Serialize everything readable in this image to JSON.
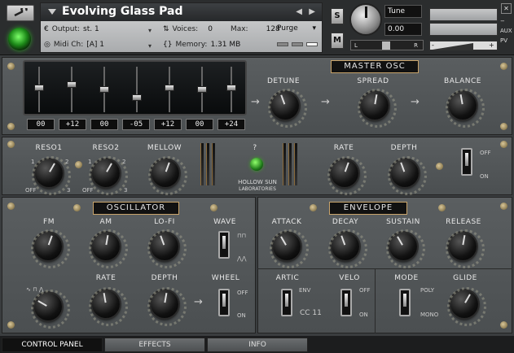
{
  "header": {
    "instrument_name": "Evolving Glass Pad",
    "output_label": "Output:",
    "output_value": "st. 1",
    "voices_label": "Voices:",
    "voices_value": "0",
    "max_label": "Max:",
    "max_value": "128",
    "purge_label": "Purge",
    "midi_label": "Midi Ch:",
    "midi_value": "[A]  1",
    "memory_label": "Memory:",
    "memory_value": "1.31 MB",
    "s_label": "S",
    "m_label": "M",
    "tune_label": "Tune",
    "tune_value": "0.00",
    "pan_l": "L",
    "pan_r": "R",
    "aux_label": "AUX",
    "pv_label": "PV",
    "vol_minus": "-",
    "vol_plus": "+"
  },
  "master_osc": {
    "title": "MASTER OSC",
    "detune": "DETUNE",
    "spread": "SPREAD",
    "balance": "BALANCE",
    "fader_values": [
      "00",
      "+12",
      "00",
      "-05",
      "+12",
      "00",
      "+24"
    ]
  },
  "filter": {
    "reso1": "RESO1",
    "reso2": "RESO2",
    "mellow": "MELLOW",
    "question": "?",
    "brand_line1": "HOLLOW SUN",
    "brand_line2": "LABORATORIES",
    "rate": "RATE",
    "depth": "DEPTH",
    "off": "OFF",
    "on": "ON",
    "reso1_off": "OFF",
    "reso1_1": "1",
    "reso1_2": "2",
    "reso1_3": "3",
    "reso2_off": "OFF",
    "reso2_1": "1",
    "reso2_2": "2",
    "reso2_3": "3"
  },
  "oscillator": {
    "title": "OSCILLATOR",
    "fm": "FM",
    "am": "AM",
    "lofi": "LO-FI",
    "wave": "WAVE",
    "rate": "RATE",
    "depth": "DEPTH",
    "wheel": "WHEEL",
    "off": "OFF",
    "on": "ON"
  },
  "envelope": {
    "title": "ENVELOPE",
    "attack": "ATTACK",
    "decay": "DECAY",
    "sustain": "SUSTAIN",
    "release": "RELEASE",
    "artic": "ARTIC",
    "env": "ENV",
    "cc": "CC 11",
    "velo": "VELO",
    "off": "OFF",
    "on": "ON",
    "mode": "MODE",
    "poly": "POLY",
    "mono": "MONO",
    "glide": "GLIDE"
  },
  "tabs": [
    "CONTROL PANEL",
    "EFFECTS",
    "INFO"
  ],
  "colors": {
    "accent_green": "#3fbf2f",
    "plate_border": "#c9a46b"
  }
}
